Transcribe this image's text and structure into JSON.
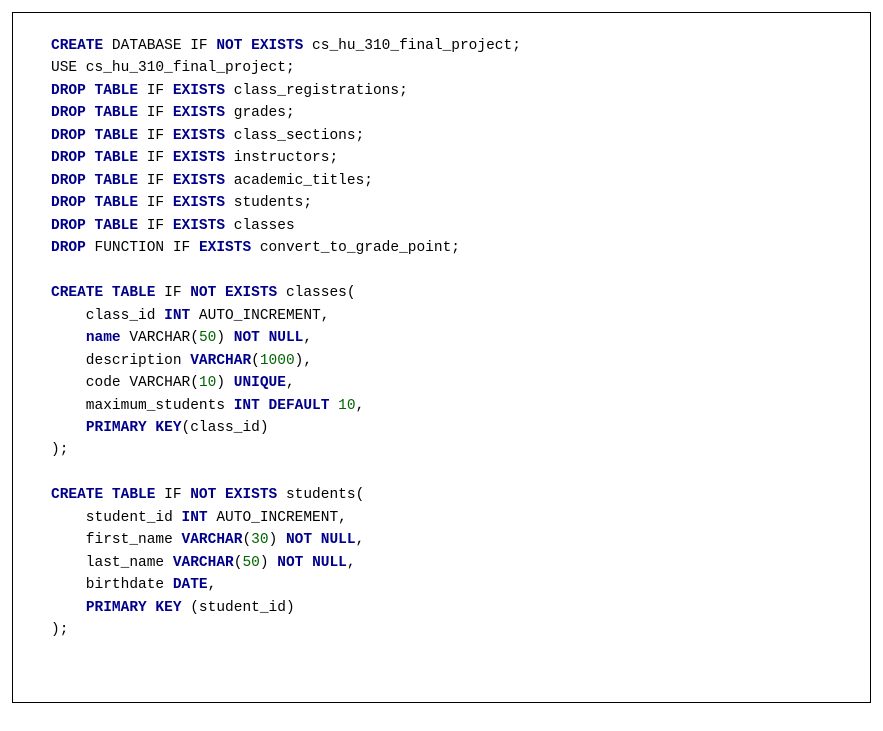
{
  "code": {
    "tokens": [
      [
        {
          "t": "CREATE",
          "c": "kw"
        },
        {
          "t": " DATABASE IF ",
          "c": "plain"
        },
        {
          "t": "NOT EXISTS",
          "c": "kw"
        },
        {
          "t": " cs_hu_310_final_project;",
          "c": "plain"
        }
      ],
      [
        {
          "t": "USE cs_hu_310_final_project;",
          "c": "plain"
        }
      ],
      [
        {
          "t": "DROP TABLE",
          "c": "kw"
        },
        {
          "t": " IF ",
          "c": "plain"
        },
        {
          "t": "EXISTS",
          "c": "kw"
        },
        {
          "t": " class_registrations;",
          "c": "plain"
        }
      ],
      [
        {
          "t": "DROP TABLE",
          "c": "kw"
        },
        {
          "t": " IF ",
          "c": "plain"
        },
        {
          "t": "EXISTS",
          "c": "kw"
        },
        {
          "t": " grades;",
          "c": "plain"
        }
      ],
      [
        {
          "t": "DROP TABLE",
          "c": "kw"
        },
        {
          "t": " IF ",
          "c": "plain"
        },
        {
          "t": "EXISTS",
          "c": "kw"
        },
        {
          "t": " class_sections;",
          "c": "plain"
        }
      ],
      [
        {
          "t": "DROP TABLE",
          "c": "kw"
        },
        {
          "t": " IF ",
          "c": "plain"
        },
        {
          "t": "EXISTS",
          "c": "kw"
        },
        {
          "t": " instructors;",
          "c": "plain"
        }
      ],
      [
        {
          "t": "DROP TABLE",
          "c": "kw"
        },
        {
          "t": " IF ",
          "c": "plain"
        },
        {
          "t": "EXISTS",
          "c": "kw"
        },
        {
          "t": " academic_titles;",
          "c": "plain"
        }
      ],
      [
        {
          "t": "DROP TABLE",
          "c": "kw"
        },
        {
          "t": " IF ",
          "c": "plain"
        },
        {
          "t": "EXISTS",
          "c": "kw"
        },
        {
          "t": " students;",
          "c": "plain"
        }
      ],
      [
        {
          "t": "DROP TABLE",
          "c": "kw"
        },
        {
          "t": " IF ",
          "c": "plain"
        },
        {
          "t": "EXISTS",
          "c": "kw"
        },
        {
          "t": " classes",
          "c": "plain"
        }
      ],
      [
        {
          "t": "DROP",
          "c": "kw"
        },
        {
          "t": " FUNCTION IF ",
          "c": "plain"
        },
        {
          "t": "EXISTS",
          "c": "kw"
        },
        {
          "t": " convert_to_grade_point;",
          "c": "plain"
        }
      ],
      [],
      [
        {
          "t": "CREATE TABLE",
          "c": "kw"
        },
        {
          "t": " IF ",
          "c": "plain"
        },
        {
          "t": "NOT EXISTS",
          "c": "kw"
        },
        {
          "t": " classes(",
          "c": "plain"
        }
      ],
      [
        {
          "t": "    class_id ",
          "c": "plain"
        },
        {
          "t": "INT",
          "c": "kw"
        },
        {
          "t": " AUTO_INCREMENT,",
          "c": "plain"
        }
      ],
      [
        {
          "t": "    ",
          "c": "plain"
        },
        {
          "t": "name",
          "c": "kw"
        },
        {
          "t": " VARCHAR(",
          "c": "plain"
        },
        {
          "t": "50",
          "c": "num"
        },
        {
          "t": ") ",
          "c": "plain"
        },
        {
          "t": "NOT NULL",
          "c": "kw"
        },
        {
          "t": ",",
          "c": "plain"
        }
      ],
      [
        {
          "t": "    description ",
          "c": "plain"
        },
        {
          "t": "VARCHAR",
          "c": "kw"
        },
        {
          "t": "(",
          "c": "plain"
        },
        {
          "t": "1000",
          "c": "num"
        },
        {
          "t": "),",
          "c": "plain"
        }
      ],
      [
        {
          "t": "    code VARCHAR(",
          "c": "plain"
        },
        {
          "t": "10",
          "c": "num"
        },
        {
          "t": ") ",
          "c": "plain"
        },
        {
          "t": "UNIQUE",
          "c": "kw"
        },
        {
          "t": ",",
          "c": "plain"
        }
      ],
      [
        {
          "t": "    maximum_students ",
          "c": "plain"
        },
        {
          "t": "INT DEFAULT",
          "c": "kw"
        },
        {
          "t": " ",
          "c": "plain"
        },
        {
          "t": "10",
          "c": "num"
        },
        {
          "t": ",",
          "c": "plain"
        }
      ],
      [
        {
          "t": "    ",
          "c": "plain"
        },
        {
          "t": "PRIMARY KEY",
          "c": "kw"
        },
        {
          "t": "(class_id)",
          "c": "plain"
        }
      ],
      [
        {
          "t": ");",
          "c": "plain"
        }
      ],
      [],
      [
        {
          "t": "CREATE TABLE",
          "c": "kw"
        },
        {
          "t": " IF ",
          "c": "plain"
        },
        {
          "t": "NOT EXISTS",
          "c": "kw"
        },
        {
          "t": " students(",
          "c": "plain"
        }
      ],
      [
        {
          "t": "    student_id ",
          "c": "plain"
        },
        {
          "t": "INT",
          "c": "kw"
        },
        {
          "t": " AUTO_INCREMENT,",
          "c": "plain"
        }
      ],
      [
        {
          "t": "    first_name ",
          "c": "plain"
        },
        {
          "t": "VARCHAR",
          "c": "kw"
        },
        {
          "t": "(",
          "c": "plain"
        },
        {
          "t": "30",
          "c": "num"
        },
        {
          "t": ") ",
          "c": "plain"
        },
        {
          "t": "NOT NULL",
          "c": "kw"
        },
        {
          "t": ",",
          "c": "plain"
        }
      ],
      [
        {
          "t": "    last_name ",
          "c": "plain"
        },
        {
          "t": "VARCHAR",
          "c": "kw"
        },
        {
          "t": "(",
          "c": "plain"
        },
        {
          "t": "50",
          "c": "num"
        },
        {
          "t": ") ",
          "c": "plain"
        },
        {
          "t": "NOT NULL",
          "c": "kw"
        },
        {
          "t": ",",
          "c": "plain"
        }
      ],
      [
        {
          "t": "    birthdate ",
          "c": "plain"
        },
        {
          "t": "DATE",
          "c": "kw"
        },
        {
          "t": ",",
          "c": "plain"
        }
      ],
      [
        {
          "t": "    ",
          "c": "plain"
        },
        {
          "t": "PRIMARY KEY",
          "c": "kw"
        },
        {
          "t": " (student_id)",
          "c": "plain"
        }
      ],
      [
        {
          "t": ");",
          "c": "plain"
        }
      ]
    ]
  }
}
